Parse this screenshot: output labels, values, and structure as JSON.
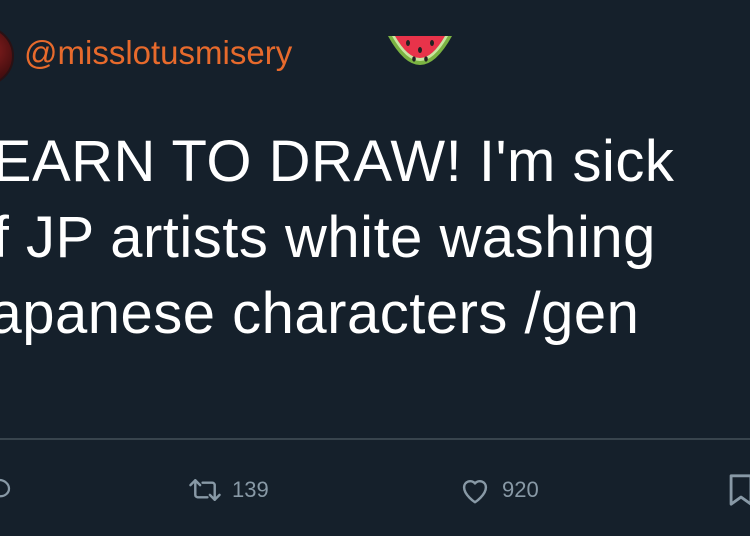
{
  "tweet": {
    "handle": "@misslotusmisery",
    "handle_emoji": "watermelon-icon",
    "text_lines": [
      "LEARN TO DRAW! I'm sick",
      "of JP artists white washing",
      "Japanese characters /gen"
    ],
    "text": "LEARN TO DRAW! I'm sick of JP artists white washing Japanese characters /gen",
    "colors": {
      "background": "#15202b",
      "handle": "#e76a2c",
      "text": "#ffffff",
      "muted": "#8899a6",
      "divider": "#38444d"
    }
  },
  "actions": {
    "reply_icon": "reply-icon",
    "retweet_icon": "retweet-icon",
    "retweet_count": "139",
    "like_icon": "heart-icon",
    "like_count": "920",
    "share_icon": "bookmark-icon"
  }
}
